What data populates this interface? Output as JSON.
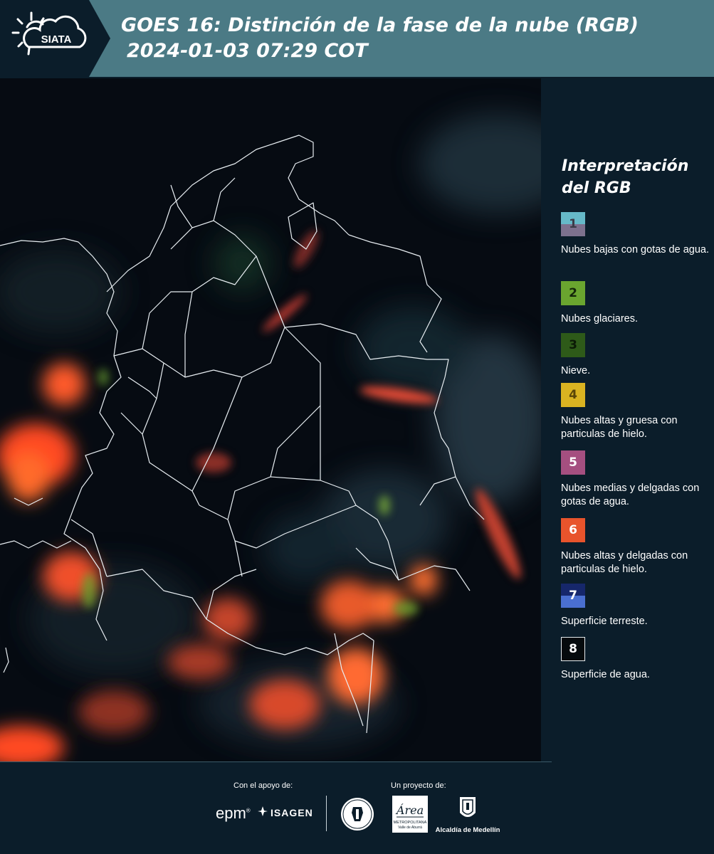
{
  "header": {
    "logo_text": "SIATA",
    "title_line1": "GOES 16: Distinción de la fase de la nube (RGB)",
    "title_line2": "2024-01-03 07:29 COT"
  },
  "legend": {
    "title": "Interpretación del RGB",
    "items": [
      {
        "number": "1",
        "label": "Nubes bajas con gotas de agua.",
        "colors": [
          "#66b9c8",
          "#7d718e"
        ]
      },
      {
        "number": "2",
        "label": "Nubes glaciares.",
        "colors": [
          "#6aa52f"
        ]
      },
      {
        "number": "3",
        "label": "Nieve.",
        "colors": [
          "#2e5a19"
        ]
      },
      {
        "number": "4",
        "label": "Nubes altas y gruesa con particulas de hielo.",
        "colors": [
          "#dab321"
        ]
      },
      {
        "number": "5",
        "label": "Nubes medias y delgadas con gotas de agua.",
        "colors": [
          "#a54f80"
        ]
      },
      {
        "number": "6",
        "label": "Nubes altas y delgadas con particulas de hielo.",
        "colors": [
          "#e8542c"
        ]
      },
      {
        "number": "7",
        "label": "Superficie terreste.",
        "colors": [
          "#16276b",
          "#4a6fd0"
        ]
      },
      {
        "number": "8",
        "label": "Superficie de agua.",
        "colors": [
          "#050a0d"
        ]
      }
    ]
  },
  "footer": {
    "support_label": "Con el apoyo de:",
    "project_label": "Un proyecto de:",
    "epm_text": "epm",
    "isagen_text": "ISAGEN",
    "area_text": "Área",
    "area_subtext1": "METROPOLITANA",
    "area_subtext2": "Valle de Aburrá",
    "alcaldia_text": "Alcaldía de Medellín"
  },
  "colors": {
    "header_bg": "#4b7a85",
    "panel_bg": "#0b1d2a",
    "ice_cloud": "#e8542c"
  }
}
